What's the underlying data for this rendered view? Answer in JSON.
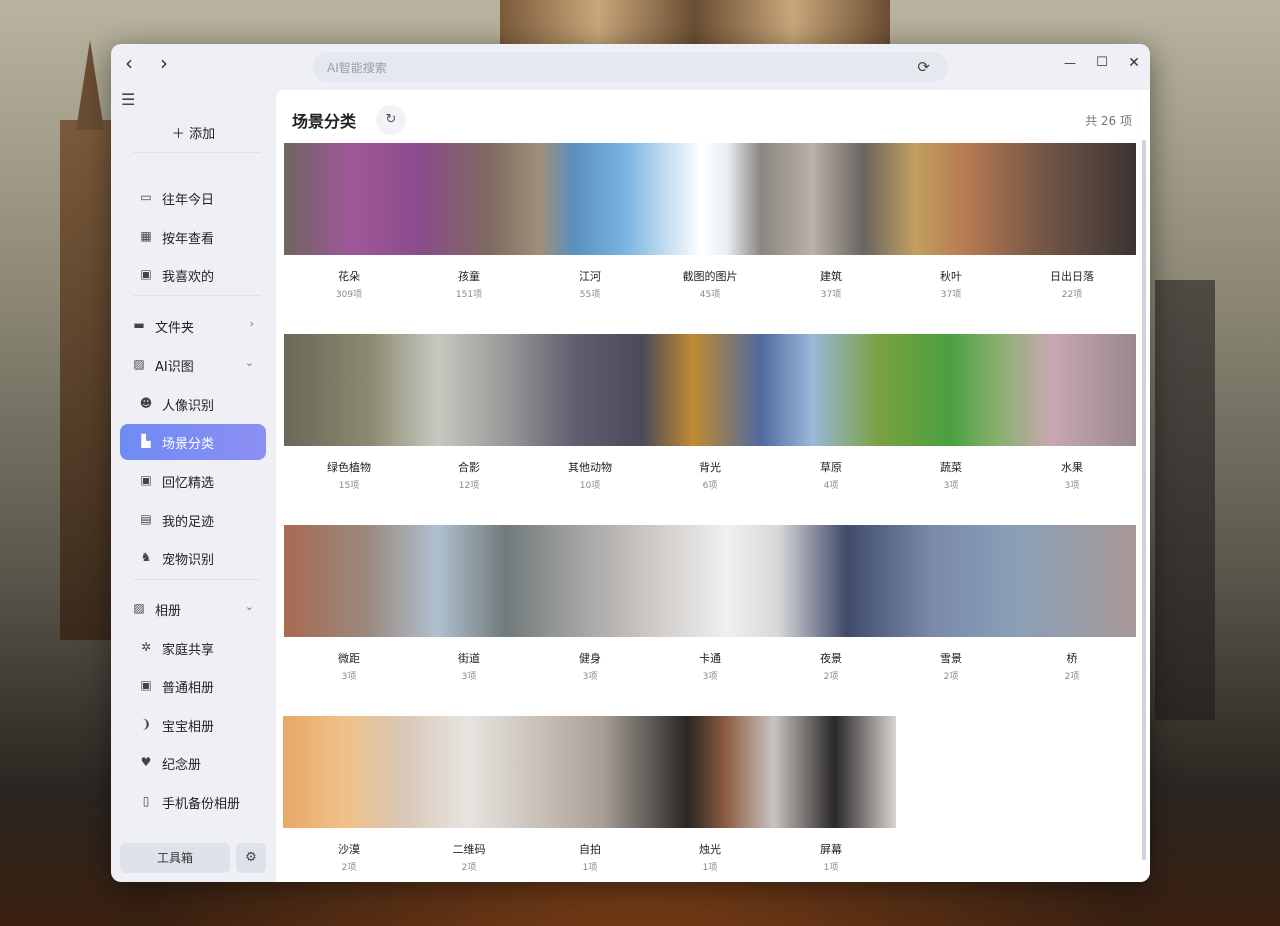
{
  "window": {
    "search_placeholder": "AI智能搜索",
    "back": "‹",
    "forward": "›",
    "minimize": "—",
    "maximize": "☐",
    "close": "✕"
  },
  "sidebar": {
    "add_label": "添加",
    "quick": [
      {
        "label": "往年今日",
        "icon": "calendar-icon"
      },
      {
        "label": "按年查看",
        "icon": "year-view-icon"
      },
      {
        "label": "我喜欢的",
        "icon": "favorite-icon"
      }
    ],
    "folders_label": "文件夹",
    "ai_label": "AI识图",
    "ai_items": [
      {
        "label": "人像识别",
        "icon": "face-icon"
      },
      {
        "label": "场景分类",
        "icon": "scene-icon"
      },
      {
        "label": "回忆精选",
        "icon": "memory-icon"
      },
      {
        "label": "我的足迹",
        "icon": "footprint-icon"
      },
      {
        "label": "宠物识别",
        "icon": "pet-icon"
      }
    ],
    "albums_label": "相册",
    "album_items": [
      {
        "label": "家庭共享",
        "icon": "family-icon"
      },
      {
        "label": "普通相册",
        "icon": "album-icon"
      },
      {
        "label": "宝宝相册",
        "icon": "baby-icon"
      },
      {
        "label": "纪念册",
        "icon": "heart-book-icon"
      },
      {
        "label": "手机备份相册",
        "icon": "phone-backup-icon"
      }
    ],
    "toolbox_label": "工具箱"
  },
  "main": {
    "title": "场景分类",
    "count": "共 26 项",
    "rows": [
      [
        {
          "name": "花朵",
          "count": "309项"
        },
        {
          "name": "孩童",
          "count": "151项"
        },
        {
          "name": "江河",
          "count": "55项"
        },
        {
          "name": "截图的图片",
          "count": "45项"
        },
        {
          "name": "建筑",
          "count": "37项"
        },
        {
          "name": "秋叶",
          "count": "37项"
        },
        {
          "name": "日出日落",
          "count": "22项"
        }
      ],
      [
        {
          "name": "绿色植物",
          "count": "15项"
        },
        {
          "name": "合影",
          "count": "12项"
        },
        {
          "name": "其他动物",
          "count": "10项"
        },
        {
          "name": "背光",
          "count": "6项"
        },
        {
          "name": "草原",
          "count": "4项"
        },
        {
          "name": "蔬菜",
          "count": "3项"
        },
        {
          "name": "水果",
          "count": "3项"
        }
      ],
      [
        {
          "name": "微距",
          "count": "3项"
        },
        {
          "name": "街道",
          "count": "3项"
        },
        {
          "name": "健身",
          "count": "3项"
        },
        {
          "name": "卡通",
          "count": "3项"
        },
        {
          "name": "夜景",
          "count": "2项"
        },
        {
          "name": "雪景",
          "count": "2项"
        },
        {
          "name": "桥",
          "count": "2项"
        }
      ],
      [
        {
          "name": "沙漠",
          "count": "2项"
        },
        {
          "name": "二维码",
          "count": "2项"
        },
        {
          "name": "自拍",
          "count": "1项"
        },
        {
          "name": "烛光",
          "count": "1项"
        },
        {
          "name": "屏幕",
          "count": "1项"
        }
      ]
    ]
  }
}
